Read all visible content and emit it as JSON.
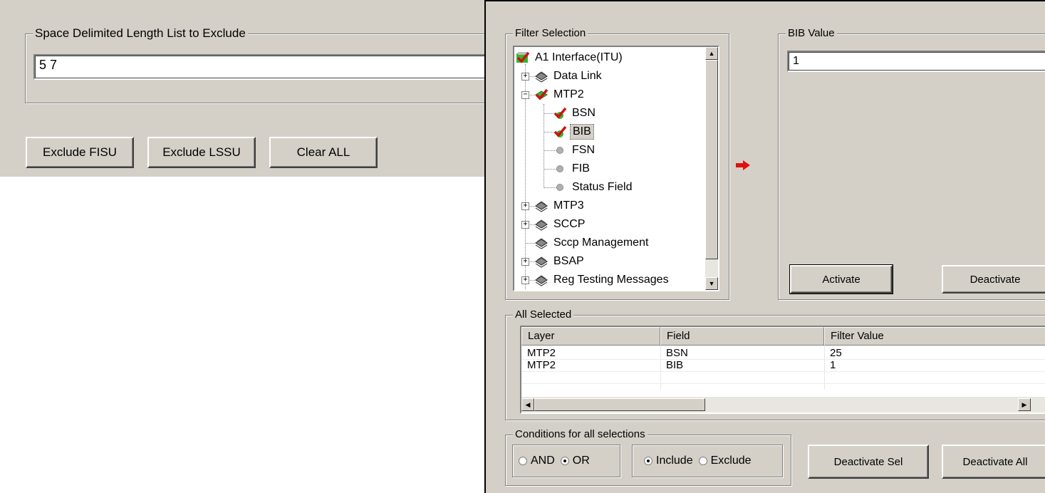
{
  "left": {
    "exclude_group_label": "Space Delimited Length List to Exclude",
    "exclude_value": "5 7",
    "buttons": {
      "exclude_fisu": "Exclude FISU",
      "exclude_lssu": "Exclude LSSU",
      "clear_all": "Clear ALL"
    }
  },
  "filter": {
    "group_label": "Filter Selection",
    "tree": [
      {
        "label": "A1 Interface(ITU)",
        "icon": "checked-layer-icon"
      },
      {
        "label": "Data Link",
        "icon": "layer-stack-icon"
      },
      {
        "label": "MTP2",
        "icon": "checked-layer-icon"
      },
      {
        "label": "BSN",
        "icon": "red-check-icon"
      },
      {
        "label": "BIB",
        "icon": "red-check-icon",
        "selected": true
      },
      {
        "label": "FSN",
        "icon": "gray-dot-icon"
      },
      {
        "label": "FIB",
        "icon": "gray-dot-icon"
      },
      {
        "label": "Status Field",
        "icon": "gray-dot-icon"
      },
      {
        "label": "MTP3",
        "icon": "layer-stack-icon"
      },
      {
        "label": "SCCP",
        "icon": "layer-stack-icon"
      },
      {
        "label": "Sccp Management",
        "icon": "layer-stack-icon"
      },
      {
        "label": "BSAP",
        "icon": "layer-stack-icon"
      },
      {
        "label": "Reg Testing Messages",
        "icon": "layer-stack-icon"
      }
    ]
  },
  "bib": {
    "group_label": "BIB Value",
    "value": "1",
    "activate_label": "Activate",
    "deactivate_label": "Deactivate"
  },
  "all_selected": {
    "group_label": "All Selected",
    "columns": [
      "Layer",
      "Field",
      "Filter Value"
    ],
    "rows": [
      [
        "MTP2",
        "BSN",
        "25"
      ],
      [
        "MTP2",
        "BIB",
        "1"
      ]
    ]
  },
  "conditions": {
    "group_label": "Conditions for all selections",
    "and_label": "AND",
    "or_label": "OR",
    "include_label": "Include",
    "exclude_label": "Exclude",
    "logic_selected": "OR",
    "mode_selected": "Include"
  },
  "bottom_buttons": {
    "deactivate_sel": "Deactivate Sel",
    "deactivate_all": "Deactivate All"
  },
  "colors": {
    "dialog_bg": "#d4d0c8",
    "check_red": "#d01010",
    "check_green": "#2fb82f",
    "arrow_red": "#e01010"
  }
}
